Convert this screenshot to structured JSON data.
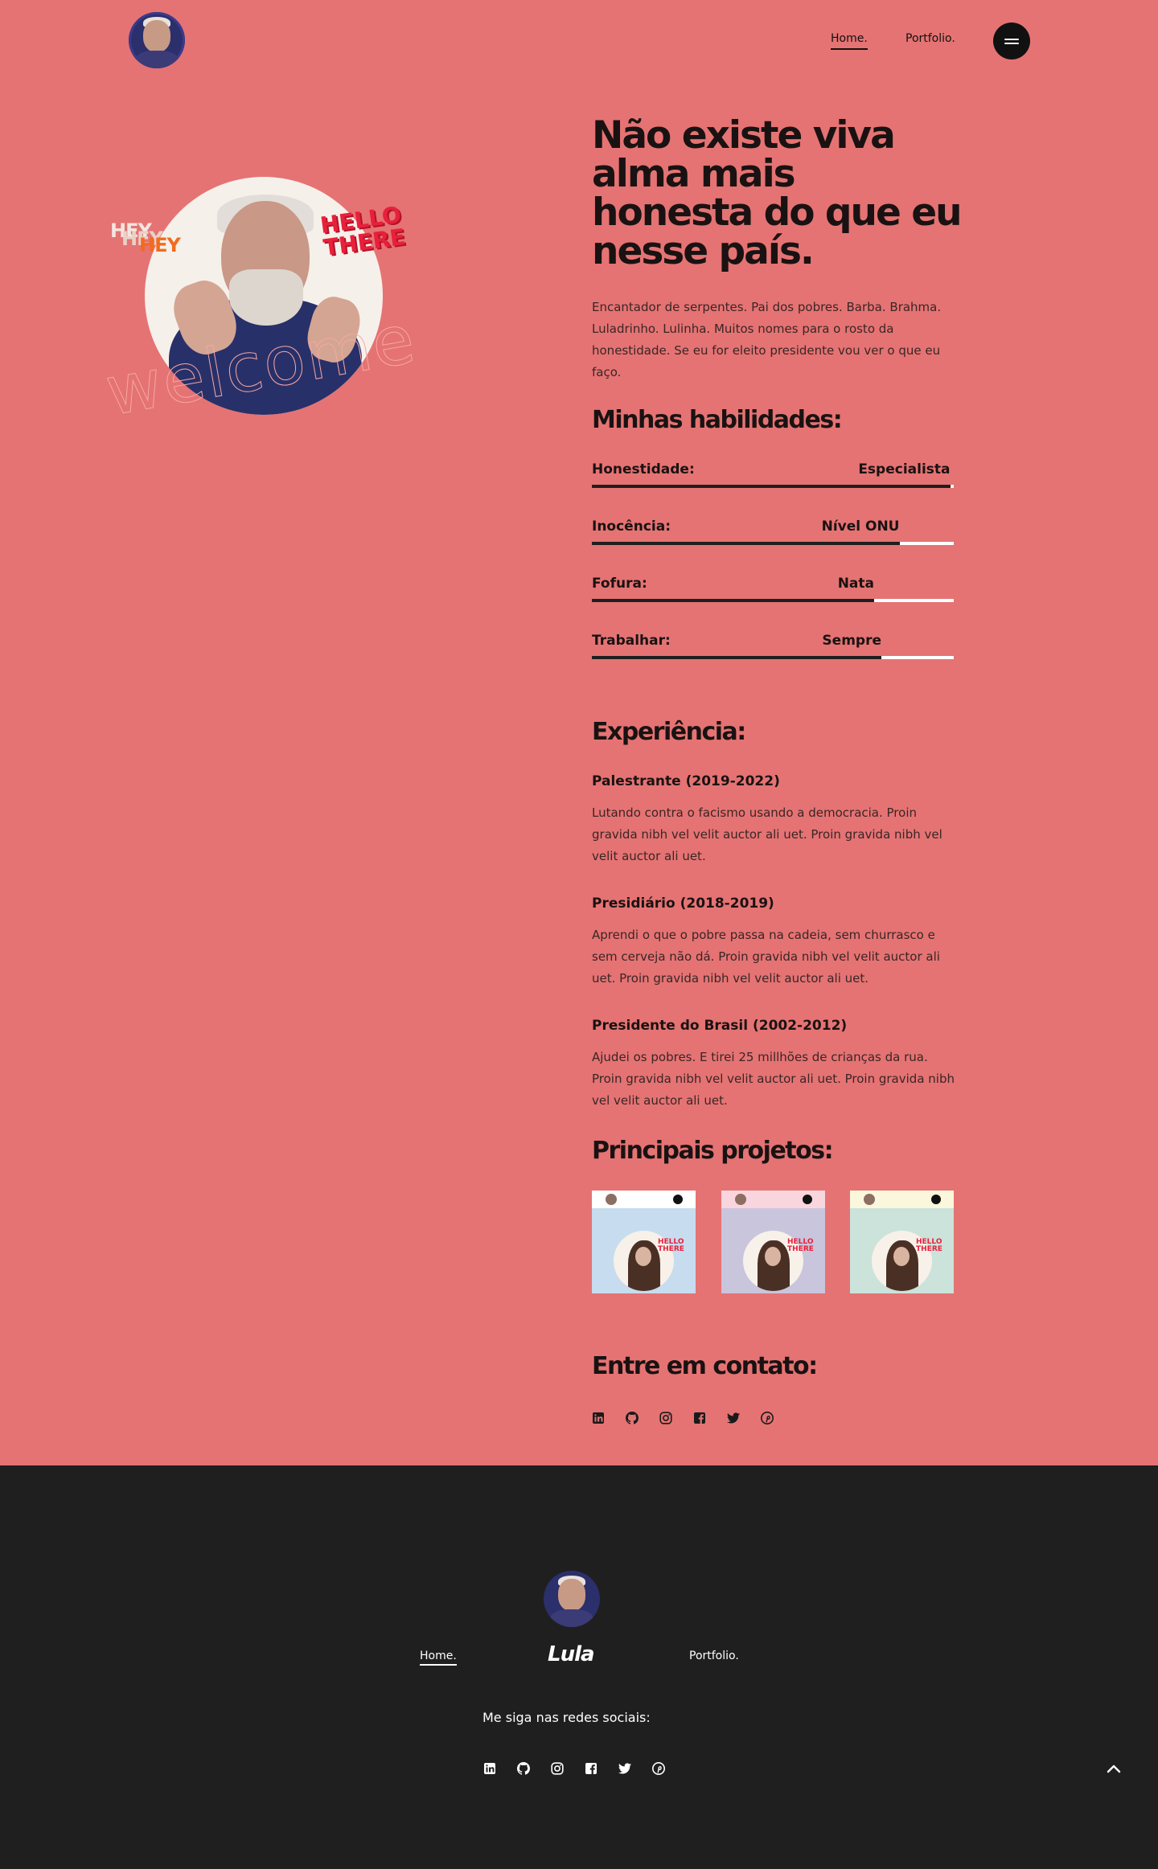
{
  "header": {
    "nav": {
      "home": "Home.",
      "portfolio": "Portfolio."
    }
  },
  "hero": {
    "sticker_hey": "HEY",
    "sticker_hello": "HELLO",
    "sticker_there": "THERE",
    "sticker_welcome": "welcome"
  },
  "about": {
    "headline": "Não existe viva alma mais honesta do que eu nesse país.",
    "intro": "Encantador de serpentes. Pai dos pobres. Barba. Brahma. Luladrinho. Lulinha. Muitos nomes para o rosto da honestidade. Se eu for eleito presidente vou ver o que eu faço."
  },
  "skills": {
    "title": "Minhas habilidades:",
    "items": [
      {
        "name": "Honestidade:",
        "level": "Especialista",
        "percent": 99
      },
      {
        "name": "Inocência:",
        "level": "Nível ONU",
        "percent": 85
      },
      {
        "name": "Fofura:",
        "level": "Nata",
        "percent": 78
      },
      {
        "name": "Trabalhar:",
        "level": "Sempre",
        "percent": 80
      }
    ]
  },
  "experience": {
    "title": "Experiência:",
    "items": [
      {
        "title": "Palestrante (2019-2022)",
        "desc": "Lutando contra o facismo usando a democracia. Proin gravida nibh vel velit auctor ali uet. Proin gravida nibh vel velit auctor ali uet."
      },
      {
        "title": "Presidiário (2018-2019)",
        "desc": "Aprendi o que o pobre passa na cadeia, sem churrasco e sem cerveja não dá. Proin gravida nibh vel velit auctor ali uet. Proin gravida nibh vel velit auctor ali uet."
      },
      {
        "title": "Presidente do Brasil (2002-2012)",
        "desc": "Ajudei os pobres. E tirei 25 millhões de crianças da rua. Proin gravida nibh vel velit auctor ali uet. Proin gravida nibh vel velit auctor ali uet."
      }
    ]
  },
  "projects": {
    "title": "Principais projetos:",
    "items": [
      {
        "bg": "#c7dcef",
        "bar": "#ffffff"
      },
      {
        "bg": "#c9c5dc",
        "bar": "#f9d6dd"
      },
      {
        "bg": "#cbe3db",
        "bar": "#fbf7dc"
      }
    ]
  },
  "contact": {
    "title": "Entre em contato:",
    "icons": [
      "linkedin-icon",
      "github-icon",
      "instagram-icon",
      "facebook-icon",
      "twitter-icon",
      "pinterest-icon"
    ]
  },
  "footer": {
    "home": "Home.",
    "brand": "Lula",
    "portfolio": "Portfolio.",
    "follow": "Me siga nas redes sociais:"
  },
  "colors": {
    "page_bg": "#e57373",
    "footer_bg": "#1f1f20",
    "accent_red": "#e8203a",
    "accent_orange": "#f26b1d"
  }
}
